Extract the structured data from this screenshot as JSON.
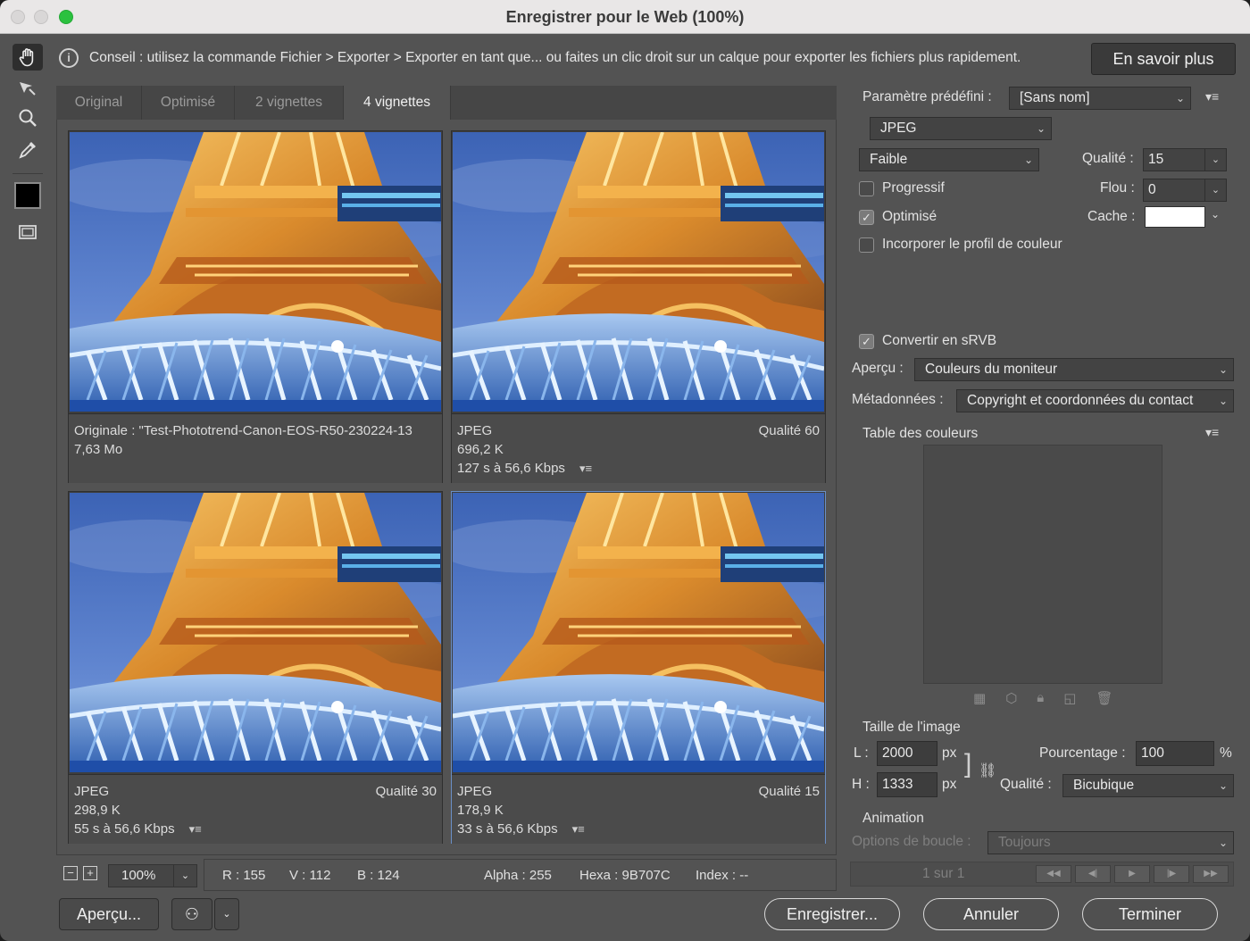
{
  "window": {
    "title": "Enregistrer pour le Web (100%)"
  },
  "hint": {
    "text": "Conseil : utilisez la commande Fichier > Exporter > Exporter en tant que... ou faites un clic droit sur un calque pour exporter les fichiers plus rapidement.",
    "learn_more": "En savoir plus"
  },
  "tools": [
    "hand-tool",
    "slice-select-tool",
    "zoom-tool",
    "eyedropper-tool",
    "eyedropper-color",
    "toggle-slices-visibility"
  ],
  "tabs": [
    {
      "label": "Original"
    },
    {
      "label": "Optimisé"
    },
    {
      "label": "2 vignettes"
    },
    {
      "label": "4 vignettes",
      "active": true
    }
  ],
  "previews": [
    {
      "line1": "Originale : \"Test-Phototrend-Canon-EOS-R50-230224-13",
      "line2": "7,63 Mo",
      "line3": "",
      "quality": ""
    },
    {
      "line1": "JPEG",
      "line2": "696,2 K",
      "line3": "127 s à 56,6 Kbps",
      "quality": "Qualité 60"
    },
    {
      "line1": "JPEG",
      "line2": "298,9 K",
      "line3": "55 s à 56,6 Kbps",
      "quality": "Qualité 30"
    },
    {
      "line1": "JPEG",
      "line2": "178,9 K",
      "line3": "33 s à 56,6 Kbps",
      "quality": "Qualité 15"
    }
  ],
  "status": {
    "zoom": "100%",
    "r": "R : 155",
    "g": "V : 112",
    "b": "B : 124",
    "alpha": "Alpha : 255",
    "hex": "Hexa : 9B707C",
    "index": "Index : --"
  },
  "settings": {
    "preset_label": "Paramètre prédéfini :",
    "preset_value": "[Sans nom]",
    "format": "JPEG",
    "quality_level": "Faible",
    "quality_label": "Qualité :",
    "quality_value": "15",
    "progressive": "Progressif",
    "blur_label": "Flou :",
    "blur_value": "0",
    "optimized": "Optimisé",
    "matte_label": "Cache :",
    "matte_color": "#ffffff",
    "embed_profile": "Incorporer le profil de couleur",
    "convert_srgb": "Convertir en sRVB",
    "preview_label": "Aperçu :",
    "preview_value": "Couleurs du moniteur",
    "metadata_label": "Métadonnées :",
    "metadata_value": "Copyright et coordonnées du contact",
    "color_table": "Table des couleurs"
  },
  "image_size": {
    "title": "Taille de l'image",
    "w_label": "L :",
    "w_value": "2000",
    "h_label": "H :",
    "h_value": "1333",
    "unit": "px",
    "percent_label": "Pourcentage :",
    "percent_value": "100",
    "percent_unit": "%",
    "quality_label": "Qualité :",
    "quality_value": "Bicubique"
  },
  "animation": {
    "title": "Animation",
    "loop_label": "Options de boucle :",
    "loop_value": "Toujours",
    "frame": "1 sur 1"
  },
  "buttons": {
    "preview": "Aperçu...",
    "save": "Enregistrer...",
    "cancel": "Annuler",
    "done": "Terminer"
  }
}
